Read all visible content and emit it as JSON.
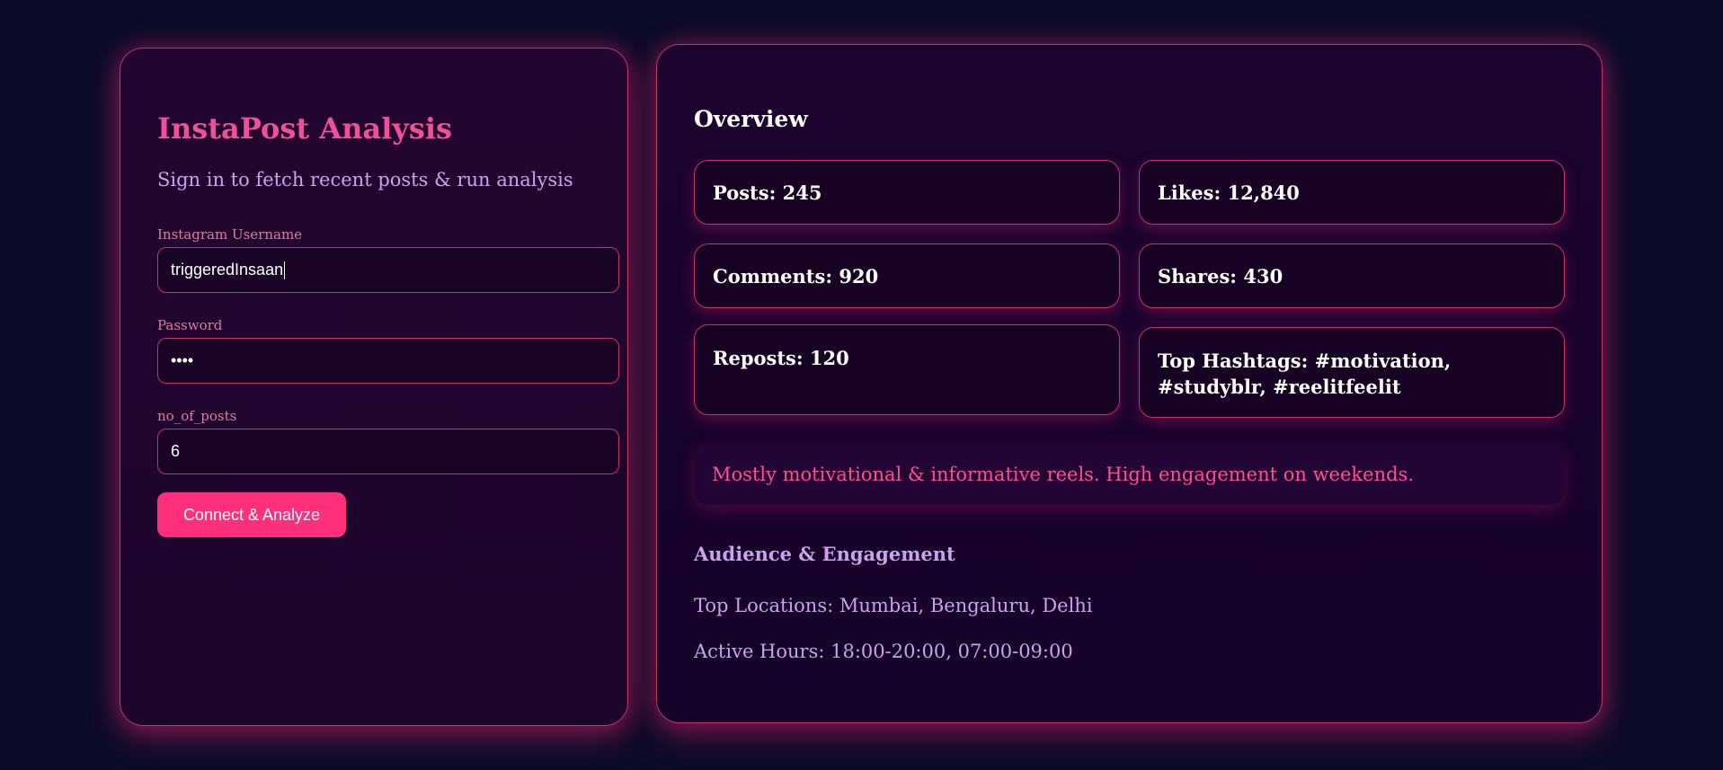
{
  "login": {
    "title": "InstaPost Analysis",
    "subtitle": "Sign in to fetch recent posts & run analysis",
    "username_label": "Instagram Username",
    "username_value": "triggeredInsaan",
    "password_label": "Password",
    "password_mask": "••••",
    "posts_label": "no_of_posts",
    "posts_value": "6",
    "connect_label": "Connect & Analyze"
  },
  "overview": {
    "title": "Overview",
    "stats": {
      "posts": "Posts: 245",
      "likes": "Likes: 12,840",
      "comments": "Comments: 920",
      "shares": "Shares: 430",
      "reposts": "Reposts: 120",
      "hashtags": "Top Hashtags: #motivation, #studyblr, #reelitfeelit"
    },
    "summary": "Mostly motivational & informative reels. High engagement on weekends.",
    "audience_heading": "Audience & Engagement",
    "top_locations": "Top Locations: Mumbai, Bengaluru, Delhi",
    "active_hours": "Active Hours: 18:00-20:00, 07:00-09:00"
  },
  "colors": {
    "background": "#0c0c28",
    "accent": "#ff2f7c",
    "title_pink": "#f0509a",
    "lavender": "#c9a4ec",
    "border": "#c8306e"
  }
}
